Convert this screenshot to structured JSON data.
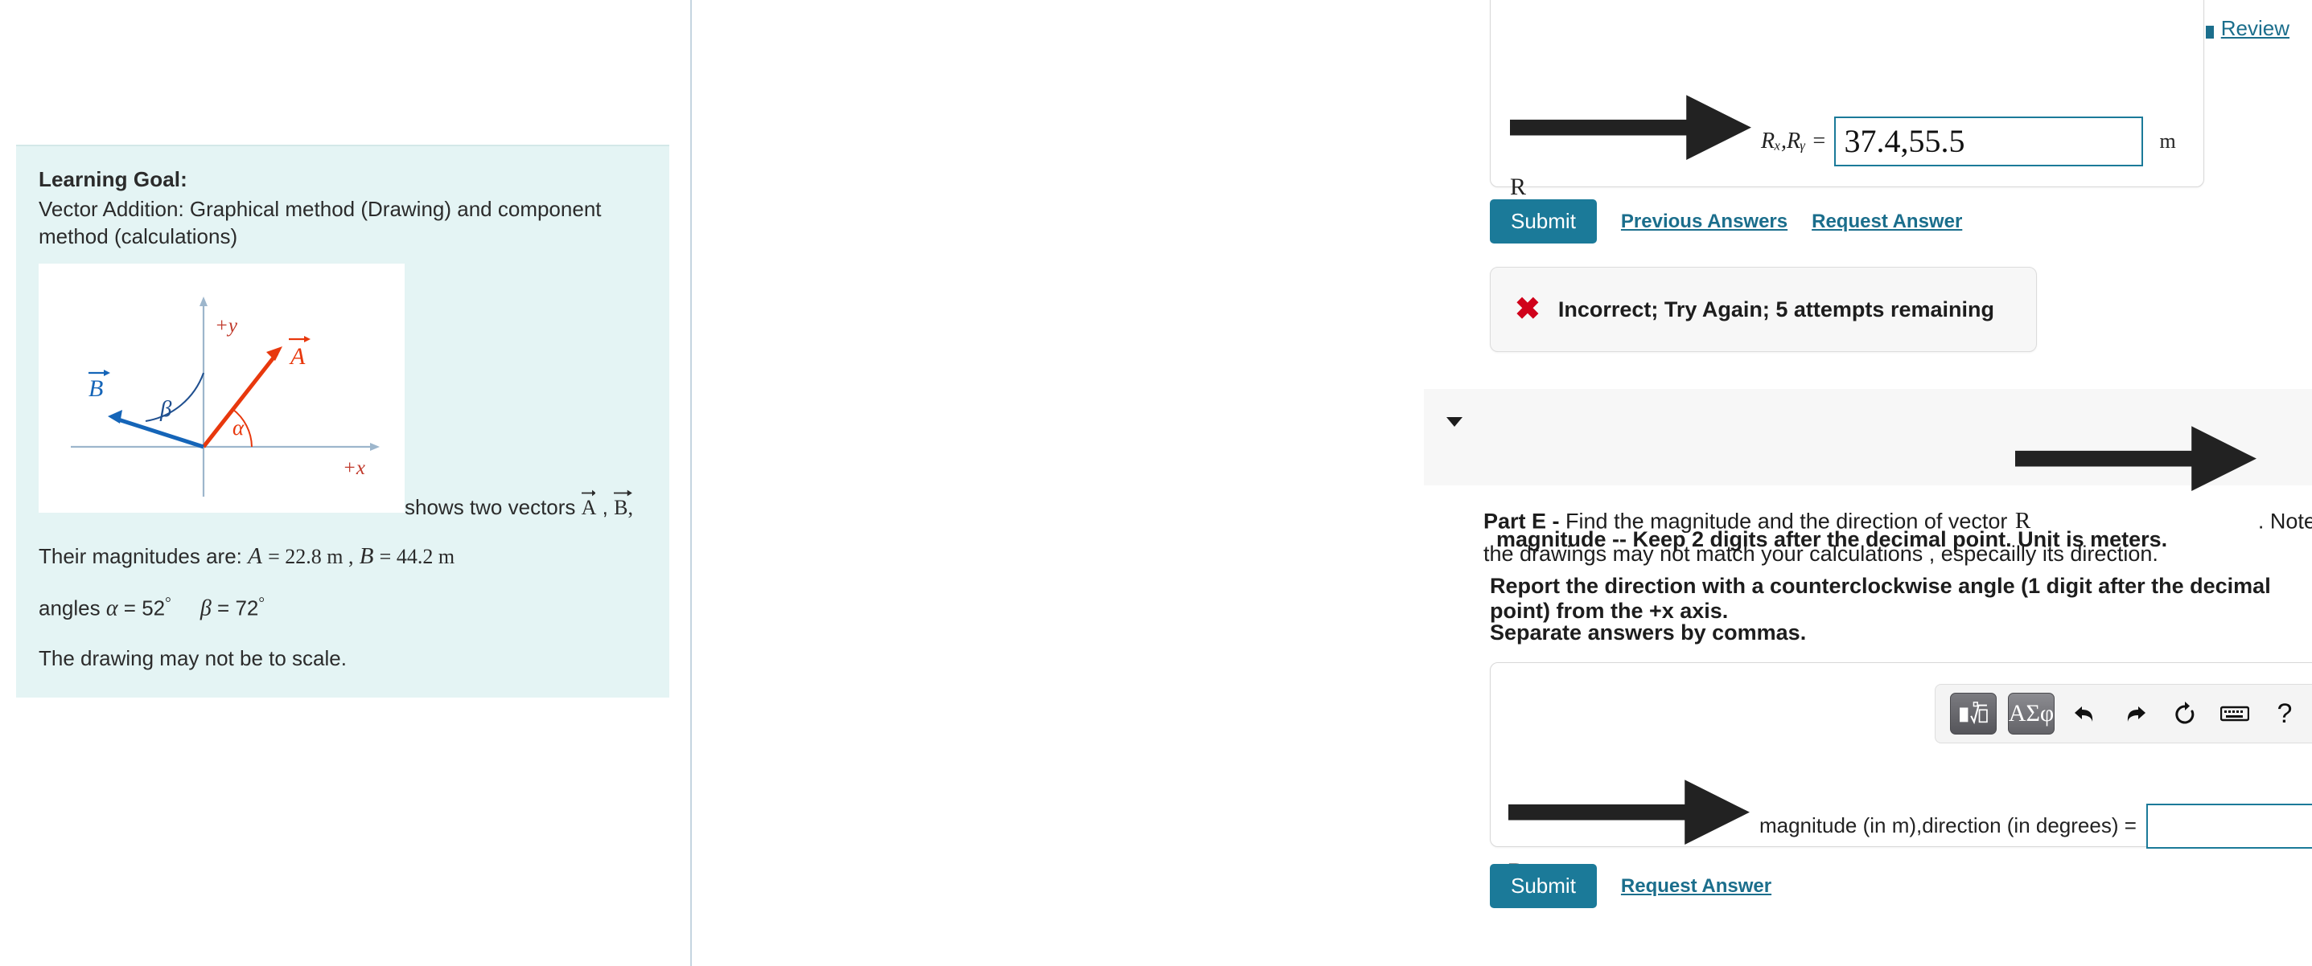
{
  "header": {
    "review_label": "Review",
    "review_icon": "book-icon"
  },
  "left_panel": {
    "learning_goal_title": "Learning Goal:",
    "learning_goal_text": "Vector Addition: Graphical method (Drawing)  and component method (calculations)",
    "figure_caption_prefix": "shows two vectors",
    "figure_caption_vec_a": "A",
    "figure_caption_comma": ",",
    "figure_caption_vec_b": "B,",
    "magnitudes_prefix": "Their magnitudes are:",
    "mag_a_symbol": "A",
    "mag_a_eq": "= 22.8 m ,",
    "mag_b_symbol": "B",
    "mag_b_eq": "= 44.2 m",
    "angles_prefix": "angles",
    "angle_alpha_symbol": "α",
    "angle_alpha_value": "= 52",
    "angle_beta_symbol": "β",
    "angle_beta_value": "= 72",
    "degree_symbol": "°",
    "scale_note": "The drawing may not be to scale.",
    "figure": {
      "axis_x_label": "+x",
      "axis_y_label": "+y",
      "vector_a_label": "A",
      "vector_b_label": "B",
      "angle_alpha_label": "α",
      "angle_beta_label": "β",
      "vector_a_color": "#e8380d",
      "vector_b_color": "#1565b8",
      "axis_color": "#9db6cc",
      "label_color": "#e8380d"
    }
  },
  "part_d": {
    "answer_symbol": "R",
    "answer_label": "Rₓ,Rᵧ =",
    "answer_value": "37.4,55.5",
    "unit": "m",
    "submit_label": "Submit",
    "previous_answers_label": "Previous Answers",
    "request_answer_label": "Request Answer",
    "feedback_icon": "x-mark-icon",
    "feedback_text": "Incorrect; Try Again; 5 attempts remaining"
  },
  "part_e": {
    "caret_icon": "caret-down-icon",
    "label": "Part E -",
    "prompt_before_vector": "Find the magnitude and the direction of vector",
    "vector_symbol": "R",
    "prompt_after_vector": ". Note: because the drawings may not be to scale, the results obtained in the drawings may not match your calculations , especailly its direction.",
    "instruction_1": "magnitude -- Keep 2 digits after the decimal point. Unit is meters.",
    "instruction_2": "Report the direction with a counterclockwise angle (1 digit after the decimal point) from the +x axis.",
    "instruction_3": "Separate answers by commas.",
    "answer_symbol": "R",
    "answer_label": "magnitude (in m),direction (in degrees) =",
    "answer_value": "",
    "submit_label": "Submit",
    "request_answer_label": "Request Answer",
    "toolbar": {
      "template_button": "template-sqrt-icon",
      "greek_button": "ΑΣφ",
      "undo": "undo-icon",
      "redo": "redo-icon",
      "reset": "reset-icon",
      "keyboard": "keyboard-icon",
      "help": "?"
    }
  },
  "colors": {
    "accent": "#1b7a99",
    "link": "#1b6e8c",
    "error": "#d0021b",
    "learning_box_bg": "#e4f4f4",
    "band_bg": "#f7f7f7"
  }
}
